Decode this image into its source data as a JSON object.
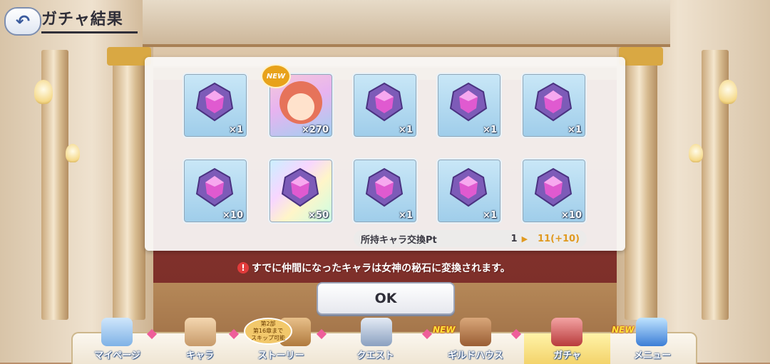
{
  "header": {
    "back_icon": "back-arrow-icon",
    "title": "ガチャ結果"
  },
  "results": [
    {
      "type": "stone",
      "qty": "×1",
      "new": false
    },
    {
      "type": "character",
      "qty": "×270",
      "new": true
    },
    {
      "type": "stone",
      "qty": "×1",
      "new": false
    },
    {
      "type": "stone",
      "qty": "×1",
      "new": false
    },
    {
      "type": "stone",
      "qty": "×1",
      "new": false
    },
    {
      "type": "stone",
      "qty": "×10",
      "new": false
    },
    {
      "type": "rainbow-stone",
      "qty": "×50",
      "new": false
    },
    {
      "type": "stone",
      "qty": "×1",
      "new": false
    },
    {
      "type": "stone",
      "qty": "×1",
      "new": false
    },
    {
      "type": "stone",
      "qty": "×10",
      "new": false
    }
  ],
  "new_label": "NEW",
  "exchange": {
    "label": "所持キャラ交換Pt",
    "from": "1",
    "to": "11(+10)"
  },
  "notice": "すでに仲間になったキャラは女神の秘石に変換されます。",
  "ok_button": "OK",
  "nav": {
    "items": [
      {
        "label": "マイページ",
        "icon": "castle-icon",
        "new": ""
      },
      {
        "label": "キャラ",
        "icon": "character-icon",
        "new": ""
      },
      {
        "label": "ストーリー",
        "icon": "book-icon",
        "new": ""
      },
      {
        "label": "クエスト",
        "icon": "sword-icon",
        "new": ""
      },
      {
        "label": "ギルドハウス",
        "icon": "door-icon",
        "new": "NEW"
      },
      {
        "label": "ガチャ",
        "icon": "gacha-icon",
        "new": ""
      },
      {
        "label": "メニュー",
        "icon": "crystal-icon",
        "new": "NEW"
      }
    ],
    "story_badge": [
      "第2部",
      "第16章まで",
      "スキップ可能"
    ]
  },
  "colors": {
    "accent_gold": "#e09a20",
    "new_badge": "#e8a21a",
    "active_tab": "#f3d36b",
    "stone_purple": "#9a62d8"
  }
}
